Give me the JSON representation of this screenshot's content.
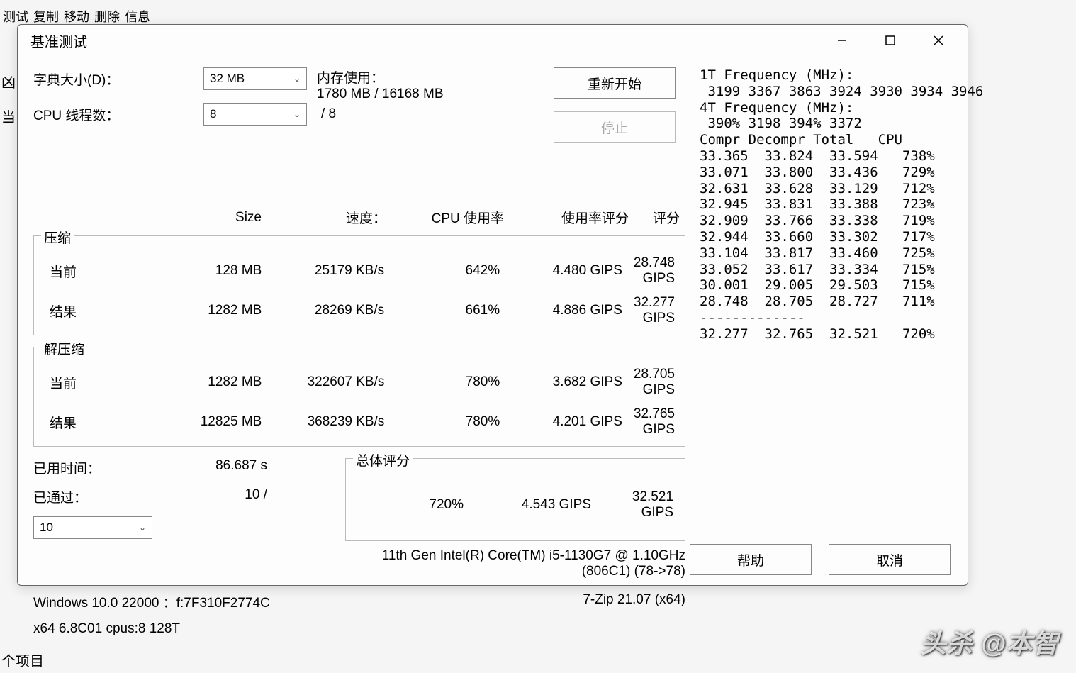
{
  "bg": {
    "menu": [
      "测试",
      "复制",
      "移动",
      "删除",
      "信息"
    ],
    "left_char1": "凶",
    "left_char2": "当",
    "bottom": "个项目"
  },
  "dialog": {
    "title": "基准测试",
    "labels": {
      "dict_size": "字典大小(D)：",
      "cpu_threads": "CPU 线程数：",
      "mem_usage": "内存使用：",
      "mem_value": "1780 MB / 16168 MB",
      "threads_total": "/ 8"
    },
    "dropdowns": {
      "dict_size": "32 MB",
      "threads": "8",
      "passes": "10"
    },
    "buttons": {
      "restart": "重新开始",
      "stop": "停止",
      "help": "帮助",
      "cancel": "取消"
    },
    "headers": {
      "size": "Size",
      "speed": "速度：",
      "cpu_usage": "CPU 使用率",
      "usage_rating": "使用率评分",
      "rating": "评分"
    },
    "sections": {
      "compress": "压缩",
      "decompress": "解压缩",
      "current": "当前",
      "result": "结果"
    },
    "compress": {
      "current": {
        "size": "128 MB",
        "speed": "25179 KB/s",
        "cpu": "642%",
        "ur": "4.480 GIPS",
        "rating": "28.748 GIPS"
      },
      "result": {
        "size": "1282 MB",
        "speed": "28269 KB/s",
        "cpu": "661%",
        "ur": "4.886 GIPS",
        "rating": "32.277 GIPS"
      }
    },
    "decompress": {
      "current": {
        "size": "1282 MB",
        "speed": "322607 KB/s",
        "cpu": "780%",
        "ur": "3.682 GIPS",
        "rating": "28.705 GIPS"
      },
      "result": {
        "size": "12825 MB",
        "speed": "368239 KB/s",
        "cpu": "780%",
        "ur": "4.201 GIPS",
        "rating": "32.765 GIPS"
      }
    },
    "elapsed_label": "已用时间：",
    "elapsed_value": "86.687 s",
    "passed_label": "已通过：",
    "passed_value": "10 /",
    "overall_label": "总体评分",
    "overall": {
      "cpu": "720%",
      "ur": "4.543 GIPS",
      "rating": "32.521 GIPS"
    },
    "cpu_name": "11th Gen Intel(R) Core(TM) i5-1130G7 @ 1.10GHz",
    "cpu_detail": "(806C1) (78->78)",
    "os": "Windows 10.0 22000 ：f:7F310F2774C",
    "zip": "7-Zip 21.07 (x64)",
    "build": "x64 6.8C01 cpus:8 128T"
  },
  "right_panel": {
    "line1": "1T Frequency (MHz):",
    "line2": " 3199 3367 3863 3924 3930 3934 3946",
    "line3": "4T Frequency (MHz):",
    "line4": " 390% 3198 394% 3372",
    "header": "Compr Decompr Total   CPU",
    "rows": [
      "33.365  33.824  33.594   738%",
      "33.071  33.800  33.436   729%",
      "32.631  33.628  33.129   712%",
      "32.945  33.831  33.388   723%",
      "32.909  33.766  33.338   719%",
      "32.944  33.660  33.302   717%",
      "33.104  33.817  33.460   725%",
      "33.052  33.617  33.334   715%",
      "30.001  29.005  29.503   715%",
      "28.748  28.705  28.727   711%"
    ],
    "sep": "-------------",
    "total": "32.277  32.765  32.521   720%"
  },
  "watermark": "头杀 @本智"
}
